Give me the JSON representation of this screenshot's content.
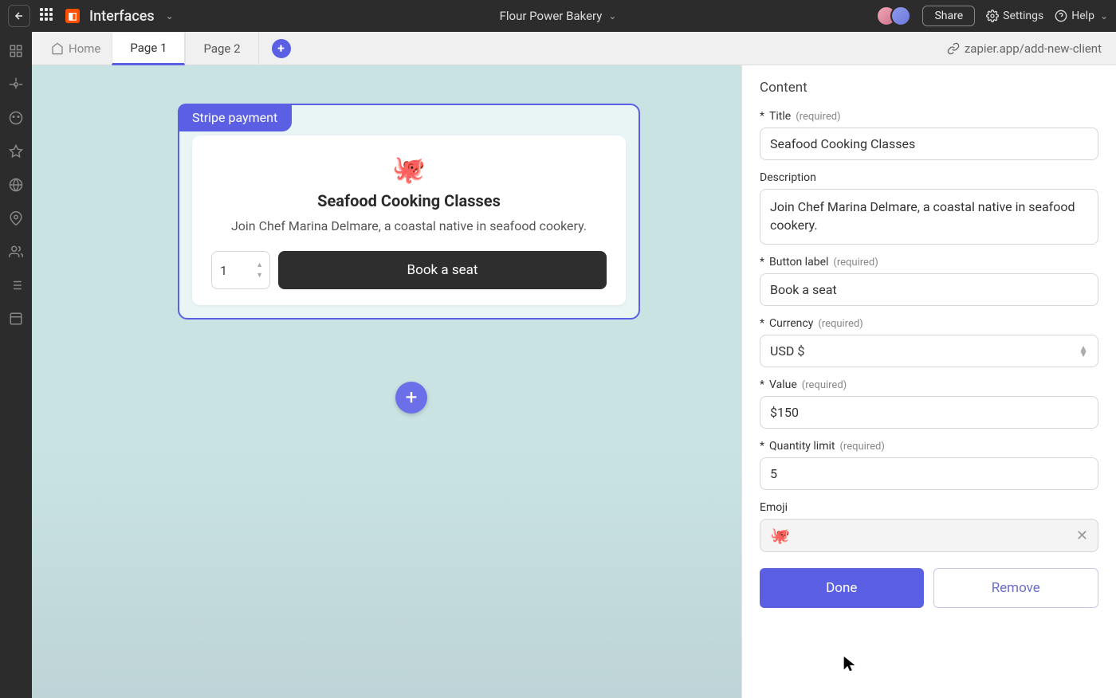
{
  "header": {
    "product_name": "Interfaces",
    "project_name": "Flour Power Bakery",
    "share_label": "Share",
    "settings_label": "Settings",
    "help_label": "Help"
  },
  "tabs": {
    "home_label": "Home",
    "items": [
      {
        "label": "Page 1",
        "active": true
      },
      {
        "label": "Page 2",
        "active": false
      }
    ],
    "url": "zapier.app/add-new-client"
  },
  "canvas": {
    "component_badge": "Stripe payment",
    "card": {
      "emoji": "🐙",
      "title": "Seafood Cooking Classes",
      "description": "Join Chef Marina Delmare, a coastal native in seafood cookery.",
      "quantity": "1",
      "button_label": "Book a seat"
    }
  },
  "panel": {
    "section_title": "Content",
    "required_text": "(required)",
    "fields": {
      "title": {
        "label": "Title",
        "value": "Seafood Cooking Classes",
        "required": true
      },
      "description": {
        "label": "Description",
        "value": "Join Chef Marina Delmare, a coastal native in seafood cookery.",
        "required": false
      },
      "button_label": {
        "label": "Button label",
        "value": "Book a seat",
        "required": true
      },
      "currency": {
        "label": "Currency",
        "value": "USD $",
        "required": true
      },
      "value": {
        "label": "Value",
        "value": "$150",
        "required": true
      },
      "quantity_limit": {
        "label": "Quantity limit",
        "value": "5",
        "required": true
      },
      "emoji": {
        "label": "Emoji",
        "value": "🐙",
        "required": false
      }
    },
    "done_label": "Done",
    "remove_label": "Remove"
  }
}
